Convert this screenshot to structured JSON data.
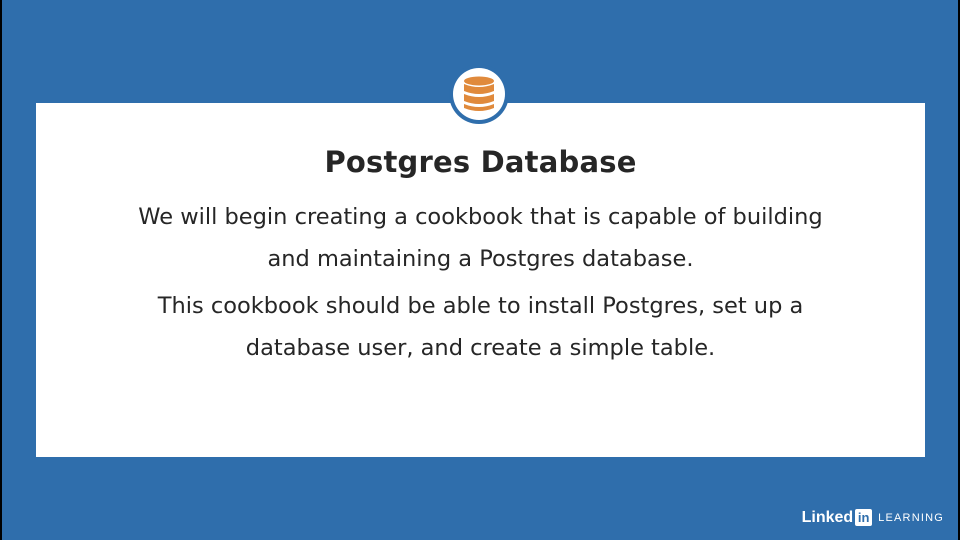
{
  "slide": {
    "icon": "database-icon",
    "title": "Postgres Database",
    "paragraph_1": [
      "We will begin creating a cookbook that is capable of building",
      "and maintaining a Postgres database."
    ],
    "paragraph_2": [
      "This cookbook should be able to install Postgres, set up a",
      "database user, and create a simple table."
    ]
  },
  "branding": {
    "linked": "Linked",
    "in": "in",
    "learning": "LEARNING"
  },
  "colors": {
    "background": "#2f6eac",
    "card": "#ffffff",
    "text": "#262626",
    "icon": "#e08a3c"
  }
}
